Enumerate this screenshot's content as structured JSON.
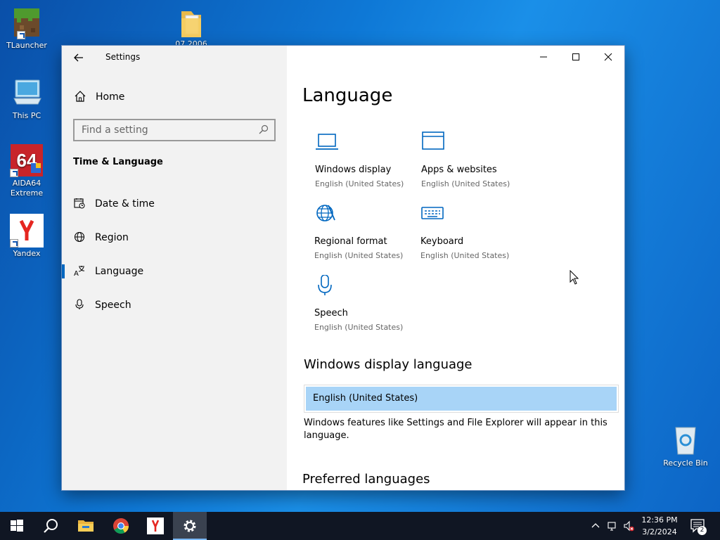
{
  "desktop": {
    "icons": [
      {
        "label": "TLauncher"
      },
      {
        "label": "07.2006"
      },
      {
        "label": "This PC"
      },
      {
        "label": "AIDA64 Extreme"
      },
      {
        "label": "Yandex"
      },
      {
        "label": "Recycle Bin"
      }
    ]
  },
  "window": {
    "title": "Settings",
    "controls": {
      "minimize": "minimize-icon",
      "maximize": "maximize-icon",
      "close": "close-icon"
    }
  },
  "sidebar": {
    "home_label": "Home",
    "search": {
      "placeholder": "Find a setting",
      "value": ""
    },
    "section_title": "Time & Language",
    "items": [
      {
        "label": "Date & time",
        "icon": "calendar-clock-icon"
      },
      {
        "label": "Region",
        "icon": "globe-icon"
      },
      {
        "label": "Language",
        "icon": "language-icon",
        "active": true
      },
      {
        "label": "Speech",
        "icon": "microphone-icon"
      }
    ]
  },
  "main": {
    "title": "Language",
    "tiles": [
      {
        "name": "Windows display",
        "sub": "English (United States)",
        "icon": "laptop-icon"
      },
      {
        "name": "Apps & websites",
        "sub": "English (United States)",
        "icon": "browser-window-icon"
      },
      {
        "name": "Regional format",
        "sub": "English (United States)",
        "icon": "regional-globe-icon"
      },
      {
        "name": "Keyboard",
        "sub": "English (United States)",
        "icon": "keyboard-icon"
      },
      {
        "name": "Speech",
        "sub": "English (United States)",
        "icon": "microphone-icon"
      }
    ],
    "display_language": {
      "heading": "Windows display language",
      "selected": "English (United States)",
      "description": "Windows features like Settings and File Explorer will appear in this language."
    },
    "preferred_heading": "Preferred languages"
  },
  "taskbar": {
    "apps": [
      "start-icon",
      "search-icon",
      "file-explorer-icon",
      "chrome-icon",
      "yandex-icon",
      "settings-icon"
    ],
    "clock": {
      "time": "12:36 PM",
      "date": "3/2/2024"
    },
    "notification_count": "2"
  },
  "colors": {
    "accent": "#0067c0",
    "selection": "#a8d4f7",
    "taskbar": "#101623",
    "sidebar": "#f2f2f2"
  }
}
